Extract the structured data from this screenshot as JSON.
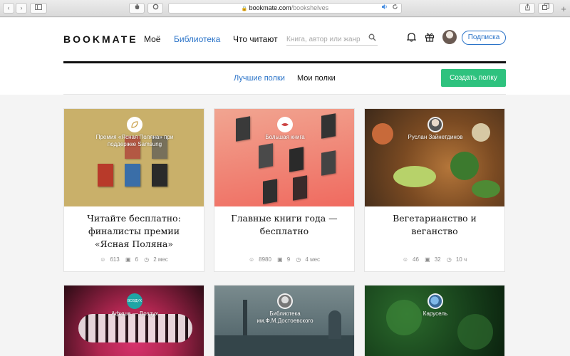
{
  "browser": {
    "url_host": "bookmate.com",
    "url_path": "/bookshelves"
  },
  "header": {
    "logo": "BOOKMATE",
    "nav": [
      "Моё",
      "Библиотека",
      "Что читают"
    ],
    "search_placeholder": "Книга, автор или жанр",
    "subscribe_label": "Подписка"
  },
  "tabs": {
    "best": "Лучшие полки",
    "mine": "Мои полки",
    "create": "Создать полку"
  },
  "cards": [
    {
      "source": "Премия «Ясная Поляна» при поддержке Samsung",
      "title": "Читайте бесплатно: финалисты премии «Ясная Поляна»",
      "followers": "613",
      "books": "6",
      "time": "2 мес"
    },
    {
      "source": "Большая книга",
      "title": "Главные книги года — бесплатно",
      "followers": "8980",
      "books": "9",
      "time": "4 мес"
    },
    {
      "source": "Руслан Зайнетдинов",
      "title": "Вегетарианство и веганство",
      "followers": "46",
      "books": "32",
      "time": "10 ч"
    },
    {
      "source": "Афиша — Воздух",
      "title": "",
      "followers": "",
      "books": "",
      "time": ""
    },
    {
      "source": "Библиотека им.Ф.М.Достоевского",
      "title": "",
      "followers": "",
      "books": "",
      "time": ""
    },
    {
      "source": "Карусель",
      "title": "",
      "followers": "",
      "books": "",
      "time": ""
    }
  ],
  "badge_letters": [
    "",
    "",
    "",
    "ВОЗДУХ",
    "",
    ""
  ],
  "colors": {
    "accent": "#2a73c8",
    "create_button": "#2ec27e"
  }
}
